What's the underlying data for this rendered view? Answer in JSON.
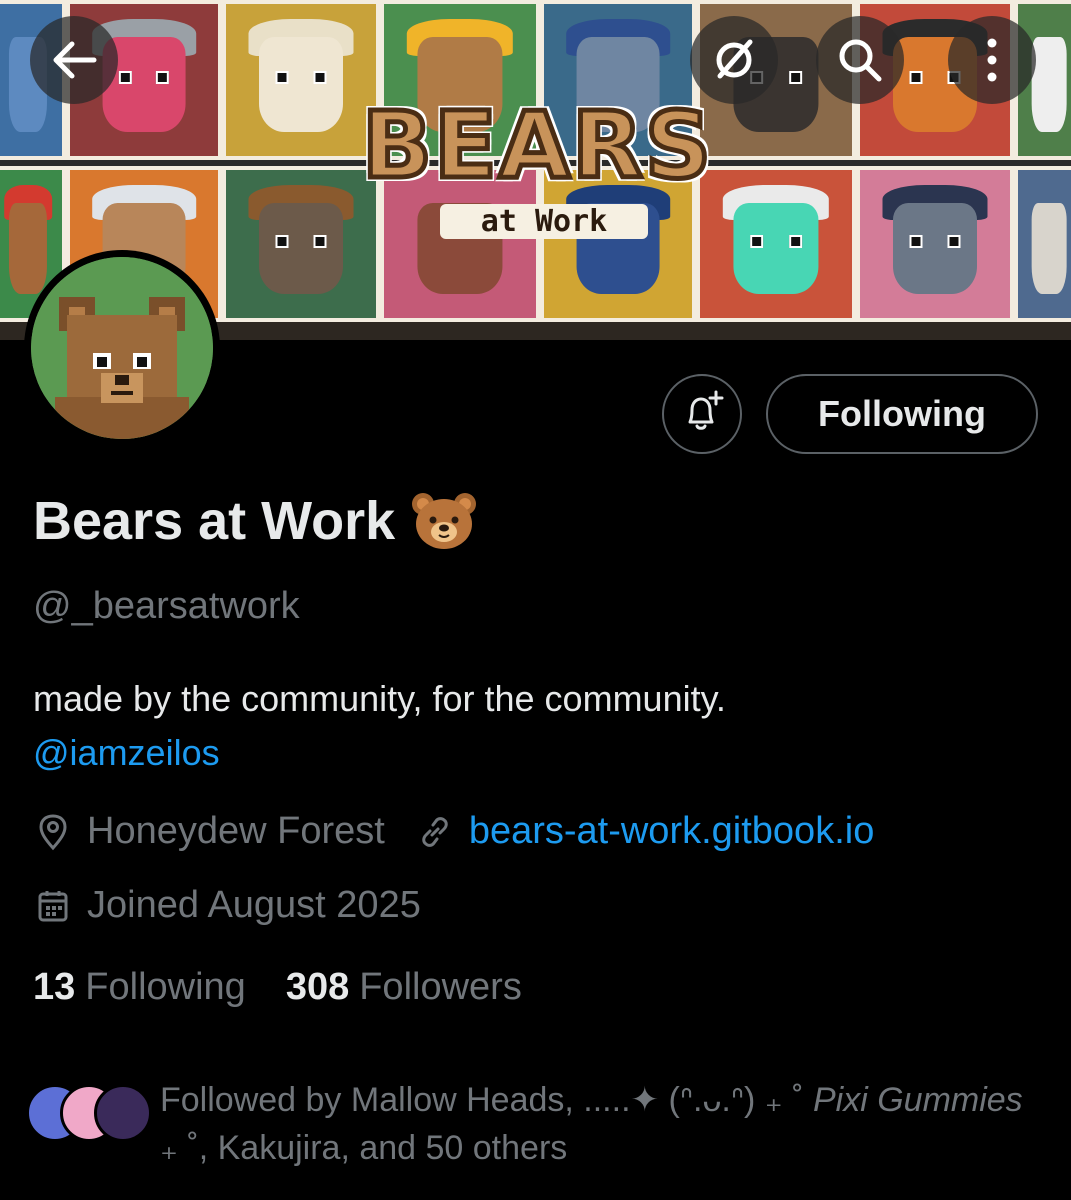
{
  "nav": {
    "back_icon": "arrow-left-icon",
    "grok_icon": "slashed-circle-icon",
    "search_icon": "search-icon",
    "more_icon": "more-vertical-icon"
  },
  "banner": {
    "logo_title": "BEARS",
    "logo_subtitle": "at Work"
  },
  "actions": {
    "notify_icon": "bell-plus-icon",
    "following_label": "Following"
  },
  "profile": {
    "display_name": "Bears at Work",
    "name_emoji": "bear-face-emoji",
    "handle": "@_bearsatwork",
    "bio_text": "made by the community, for the community.",
    "bio_mention": "@iamzeilos",
    "location": "Honeydew Forest",
    "website": "bears-at-work.gitbook.io",
    "joined": "Joined August 2025"
  },
  "stats": {
    "following_count": "13",
    "following_label": "Following",
    "followers_count": "308",
    "followers_label": "Followers"
  },
  "followed_by": {
    "prefix": "Followed by Mallow Heads, .....✦ (ᐢ.ᴗ.ᐢ) ₊ ˚ ",
    "italic_name": "Pixi Gummies",
    "suffix": " ₊ ˚, Kakujira, and 50 others"
  },
  "colors": {
    "background": "#000000",
    "text_primary": "#e7e9ea",
    "text_secondary": "#71767b",
    "link": "#1d9bf0",
    "button_border": "#5b6166",
    "avatar_bg": "#5b9a52"
  }
}
